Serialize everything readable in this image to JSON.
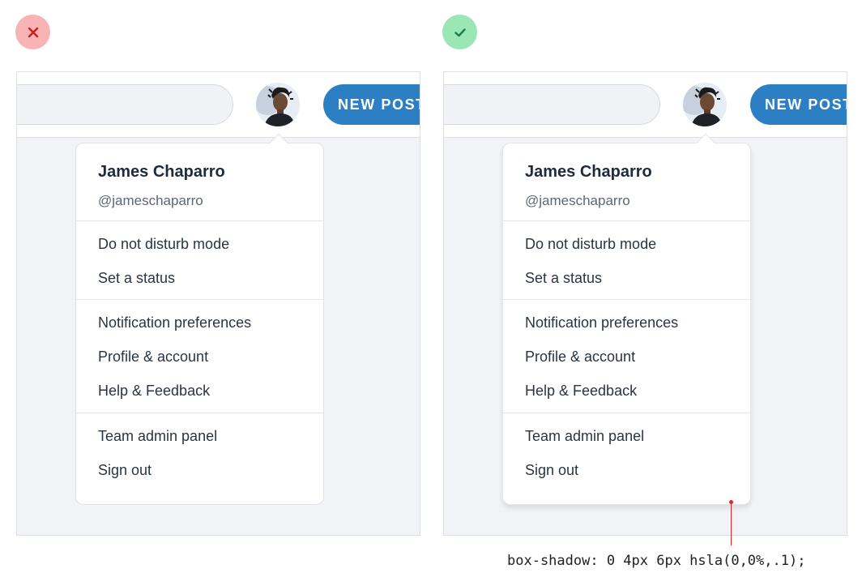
{
  "examples": [
    {
      "variant": "bad",
      "badge_icon": "close-icon",
      "badge_color": "#f8b4b4",
      "new_post_label": "NEW POST",
      "user": {
        "name": "James Chaparro",
        "handle": "@jameschaparro"
      },
      "sections": [
        [
          "Do not disturb mode",
          "Set a status"
        ],
        [
          "Notification preferences",
          "Profile & account",
          "Help & Feedback"
        ],
        [
          "Team admin panel",
          "Sign out"
        ]
      ]
    },
    {
      "variant": "good",
      "badge_icon": "check-icon",
      "badge_color": "#9ae6b4",
      "new_post_label": "NEW POST",
      "user": {
        "name": "James Chaparro",
        "handle": "@jameschaparro"
      },
      "sections": [
        [
          "Do not disturb mode",
          "Set a status"
        ],
        [
          "Notification preferences",
          "Profile & account",
          "Help & Feedback"
        ],
        [
          "Team admin panel",
          "Sign out"
        ]
      ]
    }
  ],
  "annotation": {
    "text": "box-shadow: 0 4px 6px hsla(0,0%,.1);",
    "accent": "#e02424"
  },
  "colors": {
    "brand": "#2b7fc2",
    "text": "#2b3443"
  }
}
